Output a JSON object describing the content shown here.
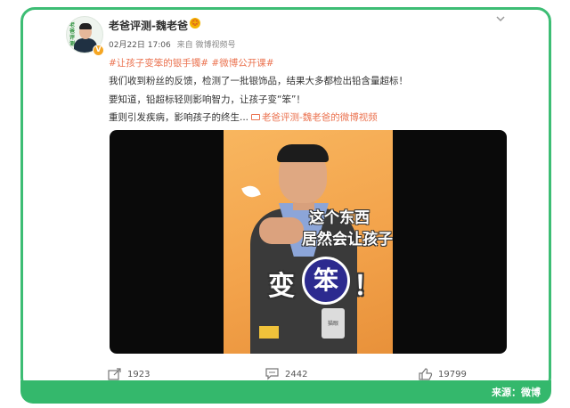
{
  "post": {
    "author": "老爸评测-魏老爸",
    "avatar_text": "老爸评测",
    "verified_badge": "V",
    "emoji_icon": "blush-face-icon",
    "date": "02月22日",
    "time": "17:06",
    "source": "来自 微博视频号",
    "hashtags": "#让孩子变笨的银手镯# #微博公开课#",
    "line1": "我们收到粉丝的反馈，检测了一批银饰品，结果大多都检出铅含量超标！",
    "line2": "要知道，铅超标轻则影响智力，让孩子变“笨”！",
    "line3_prefix": "重则引发疾病，影响孩子的终生...",
    "video_link": "老爸评测-魏老爸的微博视频"
  },
  "video": {
    "caption_line1": "这个东西",
    "caption_line2": "居然会让孩子",
    "caption_big": "变",
    "caption_circle": "笨",
    "caption_excl": "！",
    "mug_text": "猫眼"
  },
  "actions": {
    "share_count": "1923",
    "comment_count": "2442",
    "like_count": "19799"
  },
  "footer": {
    "source_label": "来源：微博"
  },
  "colors": {
    "frame_green": "#3dbd74",
    "link_orange": "#eb7350",
    "video_bg": "#f3a34b"
  }
}
